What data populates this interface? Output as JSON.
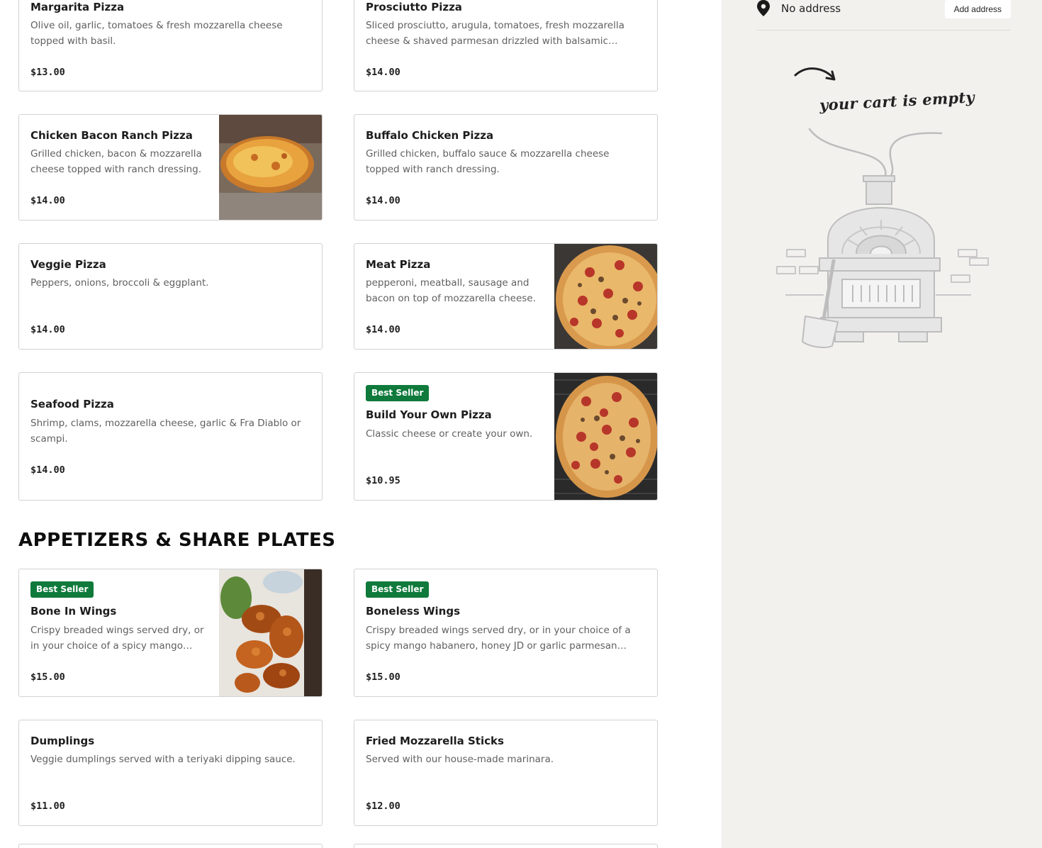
{
  "menu": {
    "row1": [
      {
        "name": "Margarita Pizza",
        "desc": "Olive oil, garlic, tomatoes & fresh mozzarella cheese topped with basil.",
        "price": "$13.00"
      },
      {
        "name": "Prosciutto Pizza",
        "desc": "Sliced prosciutto, arugula, tomatoes, fresh mozzarella cheese & shaved parmesan drizzled with balsamic reduction.",
        "price": "$14.00"
      }
    ],
    "row2": [
      {
        "name": "Chicken Bacon Ranch Pizza",
        "desc": "Grilled chicken, bacon & mozzarella cheese topped with ranch dressing.",
        "price": "$14.00"
      },
      {
        "name": "Buffalo Chicken Pizza",
        "desc": "Grilled chicken, buffalo sauce & mozzarella cheese topped with ranch dressing.",
        "price": "$14.00"
      }
    ],
    "row3": [
      {
        "name": "Veggie Pizza",
        "desc": "Peppers, onions, broccoli & eggplant.",
        "price": "$14.00"
      },
      {
        "name": "Meat Pizza",
        "desc": "pepperoni, meatball, sausage and bacon on top of mozzarella cheese.",
        "price": "$14.00"
      }
    ],
    "row4": [
      {
        "name": "Seafood Pizza",
        "desc": "Shrimp, clams, mozzarella cheese, garlic & Fra Diablo or scampi.",
        "price": "$14.00"
      },
      {
        "badge": "Best Seller",
        "name": "Build Your Own Pizza",
        "desc": "Classic cheese or create your own.",
        "price": "$10.95"
      }
    ],
    "section_title": "APPETIZERS & SHARE PLATES",
    "row5": [
      {
        "badge": "Best Seller",
        "name": "Bone In Wings",
        "desc": "Crispy breaded wings served dry, or in your choice of a spicy mango habanero, honey JD or garlic parmesan sauce.",
        "price": "$15.00"
      },
      {
        "badge": "Best Seller",
        "name": "Boneless Wings",
        "desc": "Crispy breaded wings served dry, or in your choice of a spicy mango habanero, honey JD or garlic parmesan sauce.",
        "price": "$15.00"
      }
    ],
    "row6": [
      {
        "name": "Dumplings",
        "desc": "Veggie dumplings served with a teriyaki dipping sauce.",
        "price": "$11.00"
      },
      {
        "name": "Fried Mozzarella Sticks",
        "desc": "Served with our house-made marinara.",
        "price": "$12.00"
      }
    ]
  },
  "sidebar": {
    "address_text": "No address",
    "add_address_label": "Add address",
    "empty_cart_text": "your cart is empty",
    "pin_icon": "map-pin-icon"
  },
  "colors": {
    "badge": "#0f7a3b",
    "sidebar_bg": "#f2f1ee",
    "card_border": "#d2d2d2"
  }
}
